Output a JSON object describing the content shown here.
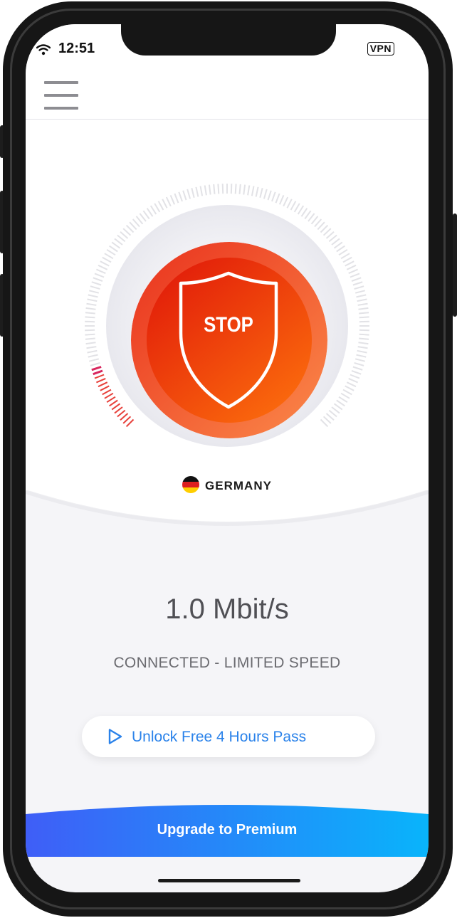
{
  "status_bar": {
    "time": "12:51",
    "vpn_badge": "VPN",
    "wifi_icon": "wifi-icon"
  },
  "header": {
    "menu_icon": "hamburger-menu-icon"
  },
  "dial": {
    "button_label": "STOP",
    "icon": "shield-icon",
    "speed_level": 0.1
  },
  "location": {
    "country": "GERMANY",
    "flag_icon": "germany-flag-icon"
  },
  "connection": {
    "speed": "1.0 Mbit/s",
    "status": "CONNECTED - LIMITED SPEED"
  },
  "unlock": {
    "label": "Unlock Free 4 Hours Pass",
    "icon": "play-icon"
  },
  "premium": {
    "label": "Upgrade to Premium"
  },
  "colors": {
    "stop_gradient_start": "#e8250b",
    "stop_gradient_end": "#fb6a0e",
    "link_blue": "#2a82ea",
    "premium_gradient_start": "#3f5ef7",
    "premium_gradient_end": "#09b4fb"
  }
}
